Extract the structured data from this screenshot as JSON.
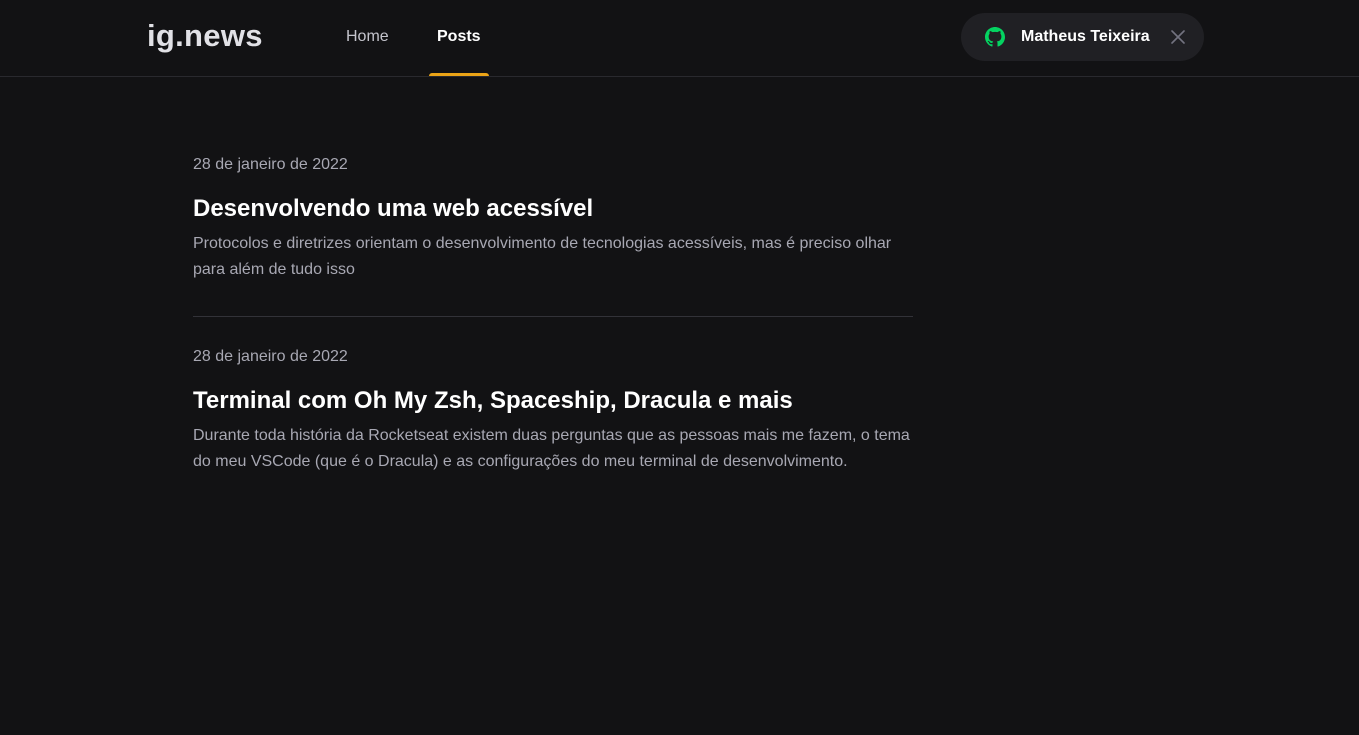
{
  "header": {
    "logo": "ig.news",
    "nav": [
      {
        "label": "Home",
        "active": false
      },
      {
        "label": "Posts",
        "active": true
      }
    ],
    "user": {
      "name": "Matheus Teixeira",
      "icon": "github-icon",
      "close_icon": "close-icon"
    }
  },
  "posts": [
    {
      "date": "28 de janeiro de 2022",
      "title": "Desenvolvendo uma web acessível",
      "excerpt": "Protocolos e diretrizes orientam o desenvolvimento de tecnologias acessíveis, mas é preciso olhar para além de tudo isso"
    },
    {
      "date": "28 de janeiro de 2022",
      "title": "Terminal com Oh My Zsh, Spaceship, Dracula e mais",
      "excerpt": "Durante toda história da Rocketseat existem duas perguntas que as pessoas mais me fazem, o tema do meu VSCode (que é o Dracula) e as configurações do meu terminal de desenvolvimento."
    }
  ],
  "colors": {
    "background": "#121214",
    "accent": "#eba417",
    "github_green": "#04d361",
    "button_bg": "#202024"
  }
}
